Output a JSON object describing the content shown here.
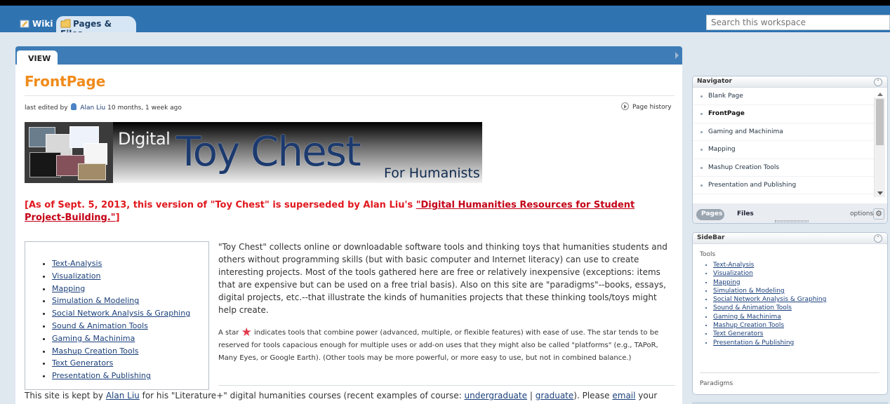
{
  "tabs": {
    "wiki": "Wiki",
    "pages_files": "Pages & Files"
  },
  "search": {
    "placeholder": "Search this workspace"
  },
  "main": {
    "view_tab": "VIEW",
    "page_title": "FrontPage",
    "meta_prefix": "last edited by",
    "editor": "Alan Liu",
    "meta_time": "10 months, 1 week ago",
    "history_link": "Page history",
    "banner": {
      "digital": "Digital",
      "title": "Toy Chest",
      "subtitle": "For Humanists"
    },
    "notice_prefix": "[As of Sept. 5, 2013, this version of \"Toy Chest\" is superseded by Alan Liu's ",
    "notice_link": "\"Digital Humanities Resources for Student Project-Building.\"",
    "notice_suffix": "]",
    "toc": [
      "Text-Analysis",
      "Visualization",
      "Mapping",
      "Simulation & Modeling",
      "Social Network Analysis & Graphing",
      "Sound & Animation Tools",
      "Gaming & Machinima",
      "Mashup Creation Tools",
      "Text Generators",
      "Presentation & Publishing"
    ],
    "intro": "\"Toy Chest\" collects online or downloadable software tools and thinking toys that humanities students and others without programming skills (but with basic computer and Internet literacy) can use to create interesting projects. Most of the tools gathered here are free or relatively inexpensive (exceptions: items that are expensive but can be used on a free trial basis). Also on this site are \"paradigms\"--books, essays, digital projects, etc.--that illustrate the kinds of humanities projects that these thinking tools/toys might help create.",
    "star_before": "A star",
    "star_after": "indicates tools that combine power (advanced, multiple, or flexible features) with ease of use. The star tends to be reserved for tools capacious enough for multiple uses or add-on uses that they might also be called \"platforms\" (e.g., TAPoR, Many Eyes, or Google Earth).  (Other tools may be more powerful, or more easy to use, but not in combined balance.)",
    "footer": {
      "start": "This site is kept by",
      "person": "Alan Liu",
      "middle": "for his \"Literature+\" digital humanities courses (recent examples of course:",
      "undergraduate": "undergraduate",
      "separator": "|",
      "graduate": "graduate",
      "after_graduate": ").  Please",
      "email": "email",
      "end": "your"
    }
  },
  "navigator": {
    "title": "Navigator",
    "items": [
      "Blank Page",
      "FrontPage",
      "Gaming and Machinima",
      "Mapping",
      "Mashup Creation Tools",
      "Presentation and Publishing"
    ],
    "pages": "Pages",
    "files": "Files",
    "options": "options"
  },
  "sidebar": {
    "title": "SideBar",
    "tools_label": "Tools",
    "links": [
      "Text-Analysis",
      "Visualization",
      "Mapping",
      "Simulation & Modeling",
      "Social Network Analysis & Graphing",
      "Sound & Animation Tools",
      "Gaming & Machinima",
      "Mashup Creation Tools",
      "Text Generators",
      "Presentation & Publishing"
    ],
    "paradigms": "Paradigms"
  }
}
